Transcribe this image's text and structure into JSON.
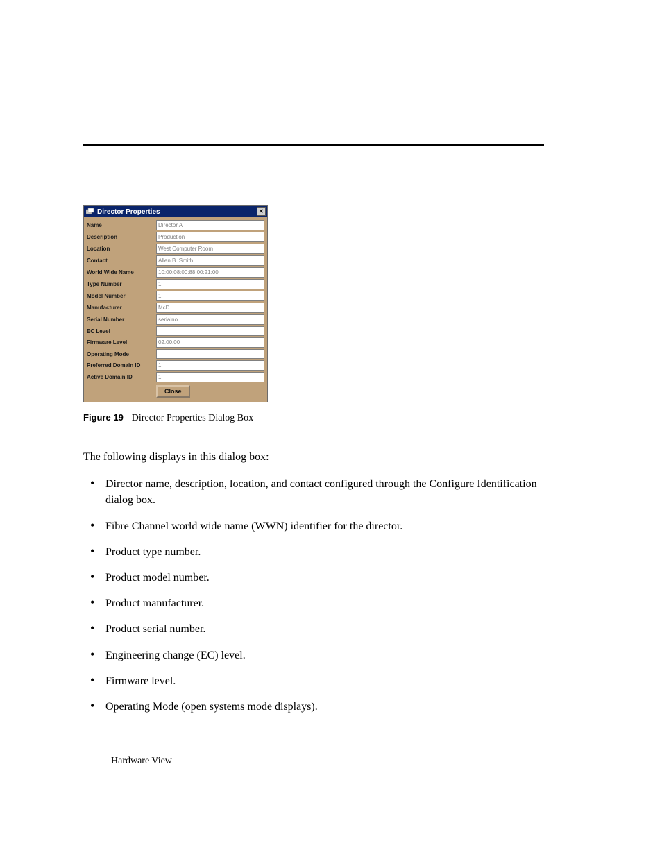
{
  "dialog": {
    "title": "Director Properties",
    "close_glyph": "✕",
    "rows": [
      {
        "label": "Name",
        "value": "Director A"
      },
      {
        "label": "Description",
        "value": "Production"
      },
      {
        "label": "Location",
        "value": "West Computer Room"
      },
      {
        "label": "Contact",
        "value": "Allen B. Smith"
      },
      {
        "label": "World Wide Name",
        "value": "10:00:08:00:88:00:21:00"
      },
      {
        "label": "Type Number",
        "value": "1"
      },
      {
        "label": "Model Number",
        "value": "1"
      },
      {
        "label": "Manufacturer",
        "value": "McD"
      },
      {
        "label": "Serial Number",
        "value": "serialno"
      },
      {
        "label": "EC Level",
        "value": ""
      },
      {
        "label": "Firmware Level",
        "value": "02.00.00"
      },
      {
        "label": "Operating Mode",
        "value": ""
      },
      {
        "label": "Preferred Domain ID",
        "value": "1"
      },
      {
        "label": "Active Domain ID",
        "value": "1"
      }
    ],
    "close_button": "Close"
  },
  "figure": {
    "label": "Figure 19",
    "caption": "Director Properties Dialog Box"
  },
  "intro": "The following displays in this dialog box:",
  "bullets": [
    "Director name, description, location, and contact configured through the Configure Identification dialog box.",
    "Fibre Channel world wide name (WWN) identifier for the director.",
    "Product type number.",
    "Product model number.",
    "Product manufacturer.",
    "Product serial number.",
    "Engineering change (EC) level.",
    "Firmware level.",
    "Operating Mode (open systems mode displays)."
  ],
  "footer": "Hardware View"
}
